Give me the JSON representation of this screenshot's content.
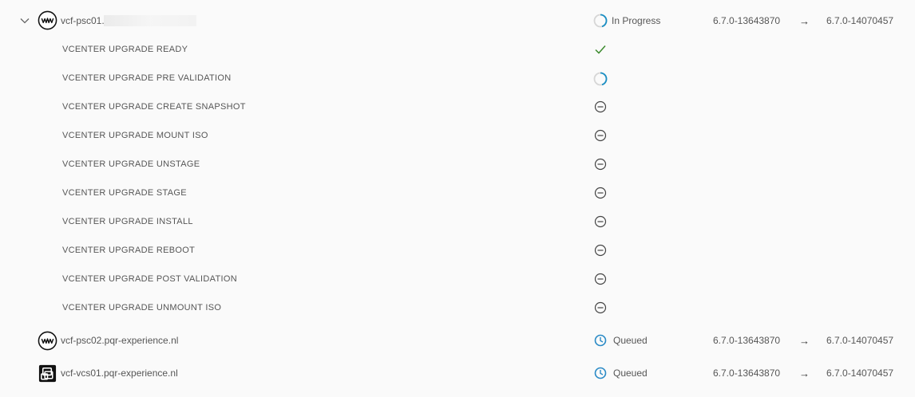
{
  "hosts": [
    {
      "name": "vcf-psc01.",
      "icon": "vmware-psc-icon",
      "status": "In Progress",
      "from_version": "6.7.0-13643870",
      "arrow": "→",
      "to_version": "6.7.0-14070457"
    },
    {
      "name": "vcf-psc02.pqr-experience.nl",
      "icon": "vmware-psc-icon",
      "status": "Queued",
      "from_version": "6.7.0-13643870",
      "arrow": "→",
      "to_version": "6.7.0-14070457"
    },
    {
      "name": "vcf-vcs01.pqr-experience.nl",
      "icon": "vcenter-icon",
      "status": "Queued",
      "from_version": "6.7.0-13643870",
      "arrow": "→",
      "to_version": "6.7.0-14070457"
    }
  ],
  "steps": [
    {
      "label": "VCENTER UPGRADE READY",
      "status": "completed"
    },
    {
      "label": "VCENTER UPGRADE PRE VALIDATION",
      "status": "in-progress"
    },
    {
      "label": "VCENTER UPGRADE CREATE SNAPSHOT",
      "status": "not-started"
    },
    {
      "label": "VCENTER UPGRADE MOUNT ISO",
      "status": "not-started"
    },
    {
      "label": "VCENTER UPGRADE UNSTAGE",
      "status": "not-started"
    },
    {
      "label": "VCENTER UPGRADE STAGE",
      "status": "not-started"
    },
    {
      "label": "VCENTER UPGRADE INSTALL",
      "status": "not-started"
    },
    {
      "label": "VCENTER UPGRADE REBOOT",
      "status": "not-started"
    },
    {
      "label": "VCENTER UPGRADE POST VALIDATION",
      "status": "not-started"
    },
    {
      "label": "VCENTER UPGRADE UNMOUNT ISO",
      "status": "not-started"
    }
  ],
  "colors": {
    "check": "#3c8a2e",
    "spinner": "#1b8fc4",
    "clock": "#2a8ac6",
    "minus": "#444444"
  }
}
